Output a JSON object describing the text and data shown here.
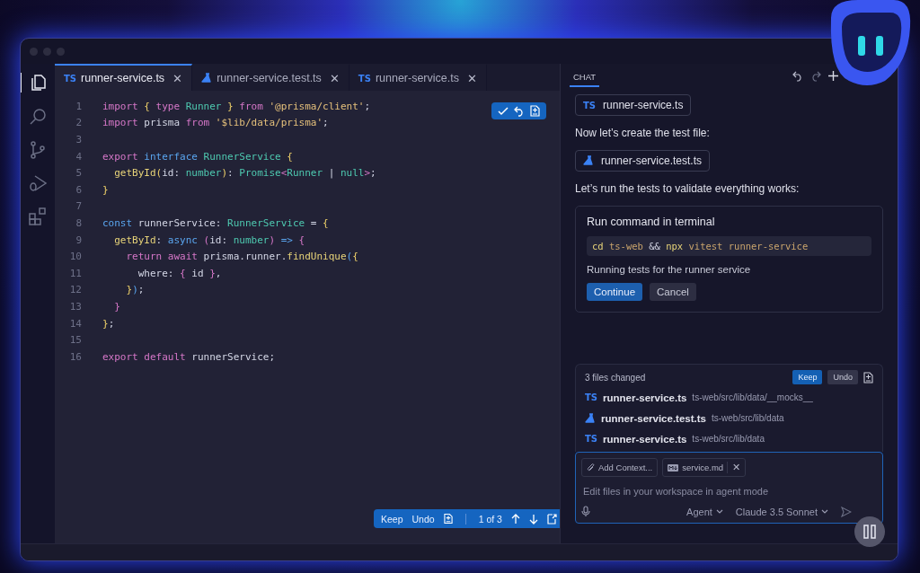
{
  "activity_bar": [
    {
      "kind": "files",
      "selected": true
    },
    {
      "kind": "search",
      "selected": false
    },
    {
      "kind": "branch",
      "selected": false
    },
    {
      "kind": "debug",
      "selected": false
    },
    {
      "kind": "extensions",
      "selected": false
    }
  ],
  "tabs": [
    {
      "label": "runner-service.ts",
      "kind": "ts",
      "icon_text": "TS",
      "close": "✕",
      "selected": true
    },
    {
      "label": "runner-service.test.ts",
      "kind": "test",
      "close": "✕",
      "selected": false
    },
    {
      "label": "runner-service.ts",
      "kind": "ts",
      "icon_text": "TS",
      "close": "✕",
      "selected": false
    }
  ],
  "editor": {
    "lines": [
      {
        "number": "1",
        "tokens": [
          {
            "kind": "keyword",
            "text": "import"
          },
          {
            "kind": "brace",
            "text": " {"
          },
          {
            "kind": "keyword",
            "text": " type"
          },
          {
            "kind": "type",
            "text": " Runner"
          },
          {
            "kind": "brace",
            "text": " }"
          },
          {
            "kind": "keyword",
            "text": " from"
          },
          {
            "kind": "string",
            "text": " '@prisma/client'"
          },
          {
            "kind": "plain",
            "text": ";"
          }
        ]
      },
      {
        "number": "2",
        "tokens": [
          {
            "kind": "keyword",
            "text": "import"
          },
          {
            "kind": "plain",
            "text": " prisma"
          },
          {
            "kind": "keyword",
            "text": " from"
          },
          {
            "kind": "string",
            "text": " '$lib/data/prisma'"
          },
          {
            "kind": "plain",
            "text": ";"
          }
        ]
      },
      {
        "number": "3"
      },
      {
        "number": "4",
        "tokens": [
          {
            "kind": "keyword",
            "text": "export"
          },
          {
            "kind": "declaration",
            "text": " interface"
          },
          {
            "kind": "type",
            "text": " RunnerService"
          },
          {
            "kind": "brace",
            "text": " {"
          }
        ]
      },
      {
        "number": "5",
        "tokens": [
          {
            "kind": "function",
            "text": "  getById"
          },
          {
            "kind": "brace",
            "text": "("
          },
          {
            "kind": "plain",
            "text": "id:"
          },
          {
            "kind": "type",
            "text": " number"
          },
          {
            "kind": "brace",
            "text": ")"
          },
          {
            "kind": "plain",
            "text": ":"
          },
          {
            "kind": "type",
            "text": " Promise"
          },
          {
            "kind": "keyword",
            "text": "<"
          },
          {
            "kind": "type",
            "text": "Runner"
          },
          {
            "kind": "plain",
            "text": " |"
          },
          {
            "kind": "type",
            "text": " null"
          },
          {
            "kind": "keyword",
            "text": ">"
          },
          {
            "kind": "plain",
            "text": ";"
          }
        ]
      },
      {
        "number": "6",
        "tokens": [
          {
            "kind": "brace",
            "text": "}"
          }
        ]
      },
      {
        "number": "7"
      },
      {
        "number": "8",
        "tokens": [
          {
            "kind": "declaration",
            "text": "const"
          },
          {
            "kind": "plain",
            "text": " runnerService:"
          },
          {
            "kind": "type",
            "text": " RunnerService"
          },
          {
            "kind": "plain",
            "text": " ="
          },
          {
            "kind": "brace",
            "text": " {"
          }
        ]
      },
      {
        "number": "9",
        "tokens": [
          {
            "kind": "function",
            "text": "  getById"
          },
          {
            "kind": "plain",
            "text": ":"
          },
          {
            "kind": "declaration",
            "text": " async"
          },
          {
            "kind": "keyword",
            "text": " ("
          },
          {
            "kind": "plain",
            "text": "id:"
          },
          {
            "kind": "type",
            "text": " number"
          },
          {
            "kind": "keyword",
            "text": ")"
          },
          {
            "kind": "declaration",
            "text": " =>"
          },
          {
            "kind": "keyword",
            "text": " {"
          }
        ]
      },
      {
        "number": "10",
        "tokens": [
          {
            "kind": "keyword",
            "text": "    return"
          },
          {
            "kind": "keyword",
            "text": " await"
          },
          {
            "kind": "plain",
            "text": " prisma.runner."
          },
          {
            "kind": "function",
            "text": "findUnique"
          },
          {
            "kind": "declaration",
            "text": "("
          },
          {
            "kind": "brace",
            "text": "{"
          }
        ]
      },
      {
        "number": "11",
        "tokens": [
          {
            "kind": "plain",
            "text": "      where:"
          },
          {
            "kind": "keyword",
            "text": " {"
          },
          {
            "kind": "plain",
            "text": " id"
          },
          {
            "kind": "keyword",
            "text": " }"
          },
          {
            "kind": "plain",
            "text": ","
          }
        ]
      },
      {
        "number": "12",
        "tokens": [
          {
            "kind": "brace",
            "text": "    }"
          },
          {
            "kind": "declaration",
            "text": ")"
          },
          {
            "kind": "plain",
            "text": ";"
          }
        ]
      },
      {
        "number": "13",
        "tokens": [
          {
            "kind": "keyword",
            "text": "  }"
          }
        ]
      },
      {
        "number": "14",
        "tokens": [
          {
            "kind": "brace",
            "text": "}"
          },
          {
            "kind": "plain",
            "text": ";"
          }
        ]
      },
      {
        "number": "15"
      },
      {
        "number": "16",
        "tokens": [
          {
            "kind": "keyword",
            "text": "export"
          },
          {
            "kind": "keyword",
            "text": " default"
          },
          {
            "kind": "plain",
            "text": " runnerService;"
          }
        ]
      }
    ],
    "review_bar": {
      "keep": "Keep",
      "undo": "Undo",
      "position": "1 of 3"
    }
  },
  "chat": {
    "tab": {
      "label": "CHAT",
      "selected": true
    },
    "messages": [
      {
        "kind": "file",
        "file": {
          "kind": "ts",
          "icon_text": "TS",
          "label": "runner-service.ts"
        }
      },
      {
        "kind": "text",
        "text": "Now let’s create the test file:"
      },
      {
        "kind": "file",
        "file": {
          "kind": "test",
          "label": "runner-service.test.ts"
        }
      },
      {
        "kind": "text",
        "text": "Let’s run the tests to validate everything works:"
      },
      {
        "kind": "command",
        "title": "Run command in terminal",
        "command": [
          {
            "kind": "function",
            "text": "cd"
          },
          {
            "kind": "argument",
            "text": " ts-web"
          },
          {
            "kind": "plain",
            "text": " &&"
          },
          {
            "kind": "function",
            "text": " npx"
          },
          {
            "kind": "argument",
            "text": " vitest runner-service"
          }
        ],
        "description": "Running tests for the runner service",
        "primary": "Continue",
        "secondary": "Cancel"
      }
    ],
    "changes": {
      "summary": "3 files changed",
      "keep": "Keep",
      "undo": "Undo",
      "files": [
        {
          "kind": "ts",
          "icon_text": "TS",
          "name": "runner-service.ts",
          "path": "ts-web/src/lib/data/__mocks__"
        },
        {
          "kind": "test",
          "name": "runner-service.test.ts",
          "path": "ts-web/src/lib/data"
        },
        {
          "kind": "ts",
          "icon_text": "TS",
          "name": "runner-service.ts",
          "path": "ts-web/src/lib/data"
        }
      ]
    },
    "composer": {
      "chips": [
        {
          "kind": "attach",
          "label": "Add Context..."
        },
        {
          "kind": "file",
          "label": "service.md",
          "remove": "✕"
        }
      ],
      "placeholder": "Edit files in your workspace in agent mode",
      "mode": "Agent",
      "model": "Claude 3.5 Sonnet"
    }
  }
}
